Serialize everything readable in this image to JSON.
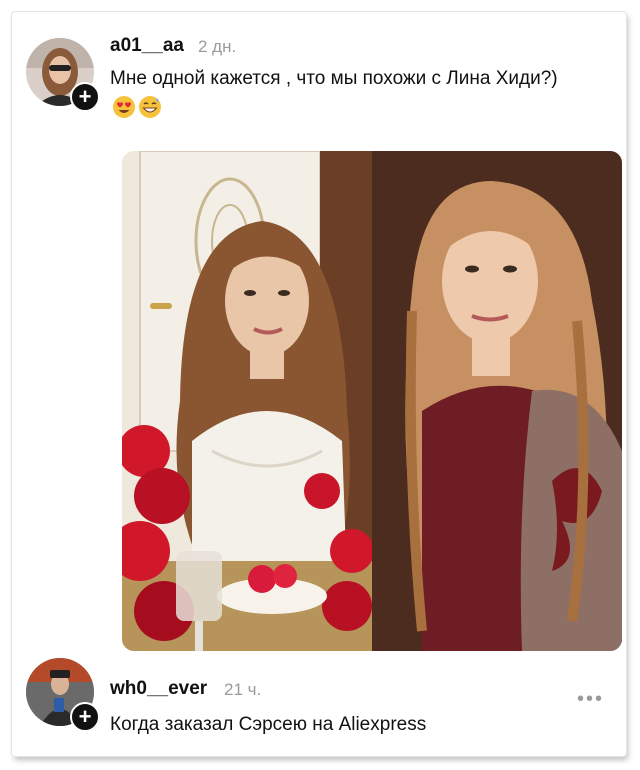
{
  "comments": [
    {
      "username": "a01__aa",
      "time": "2 дн.",
      "text": "Мне одной кажется , что мы похожи с Лина Хиди?)",
      "emojis": [
        "heart-eyes-emoji",
        "grinning-sweat-emoji"
      ]
    },
    {
      "username": "wh0__ever",
      "time": "21 ч.",
      "text": "Когда заказал Сэрсею на Aliexpress"
    }
  ],
  "icons": {
    "follow": "plus-icon",
    "more": "more-dots-icon"
  },
  "colors": {
    "text": "#111111",
    "muted": "#9b9b9b",
    "background": "#ffffff"
  }
}
